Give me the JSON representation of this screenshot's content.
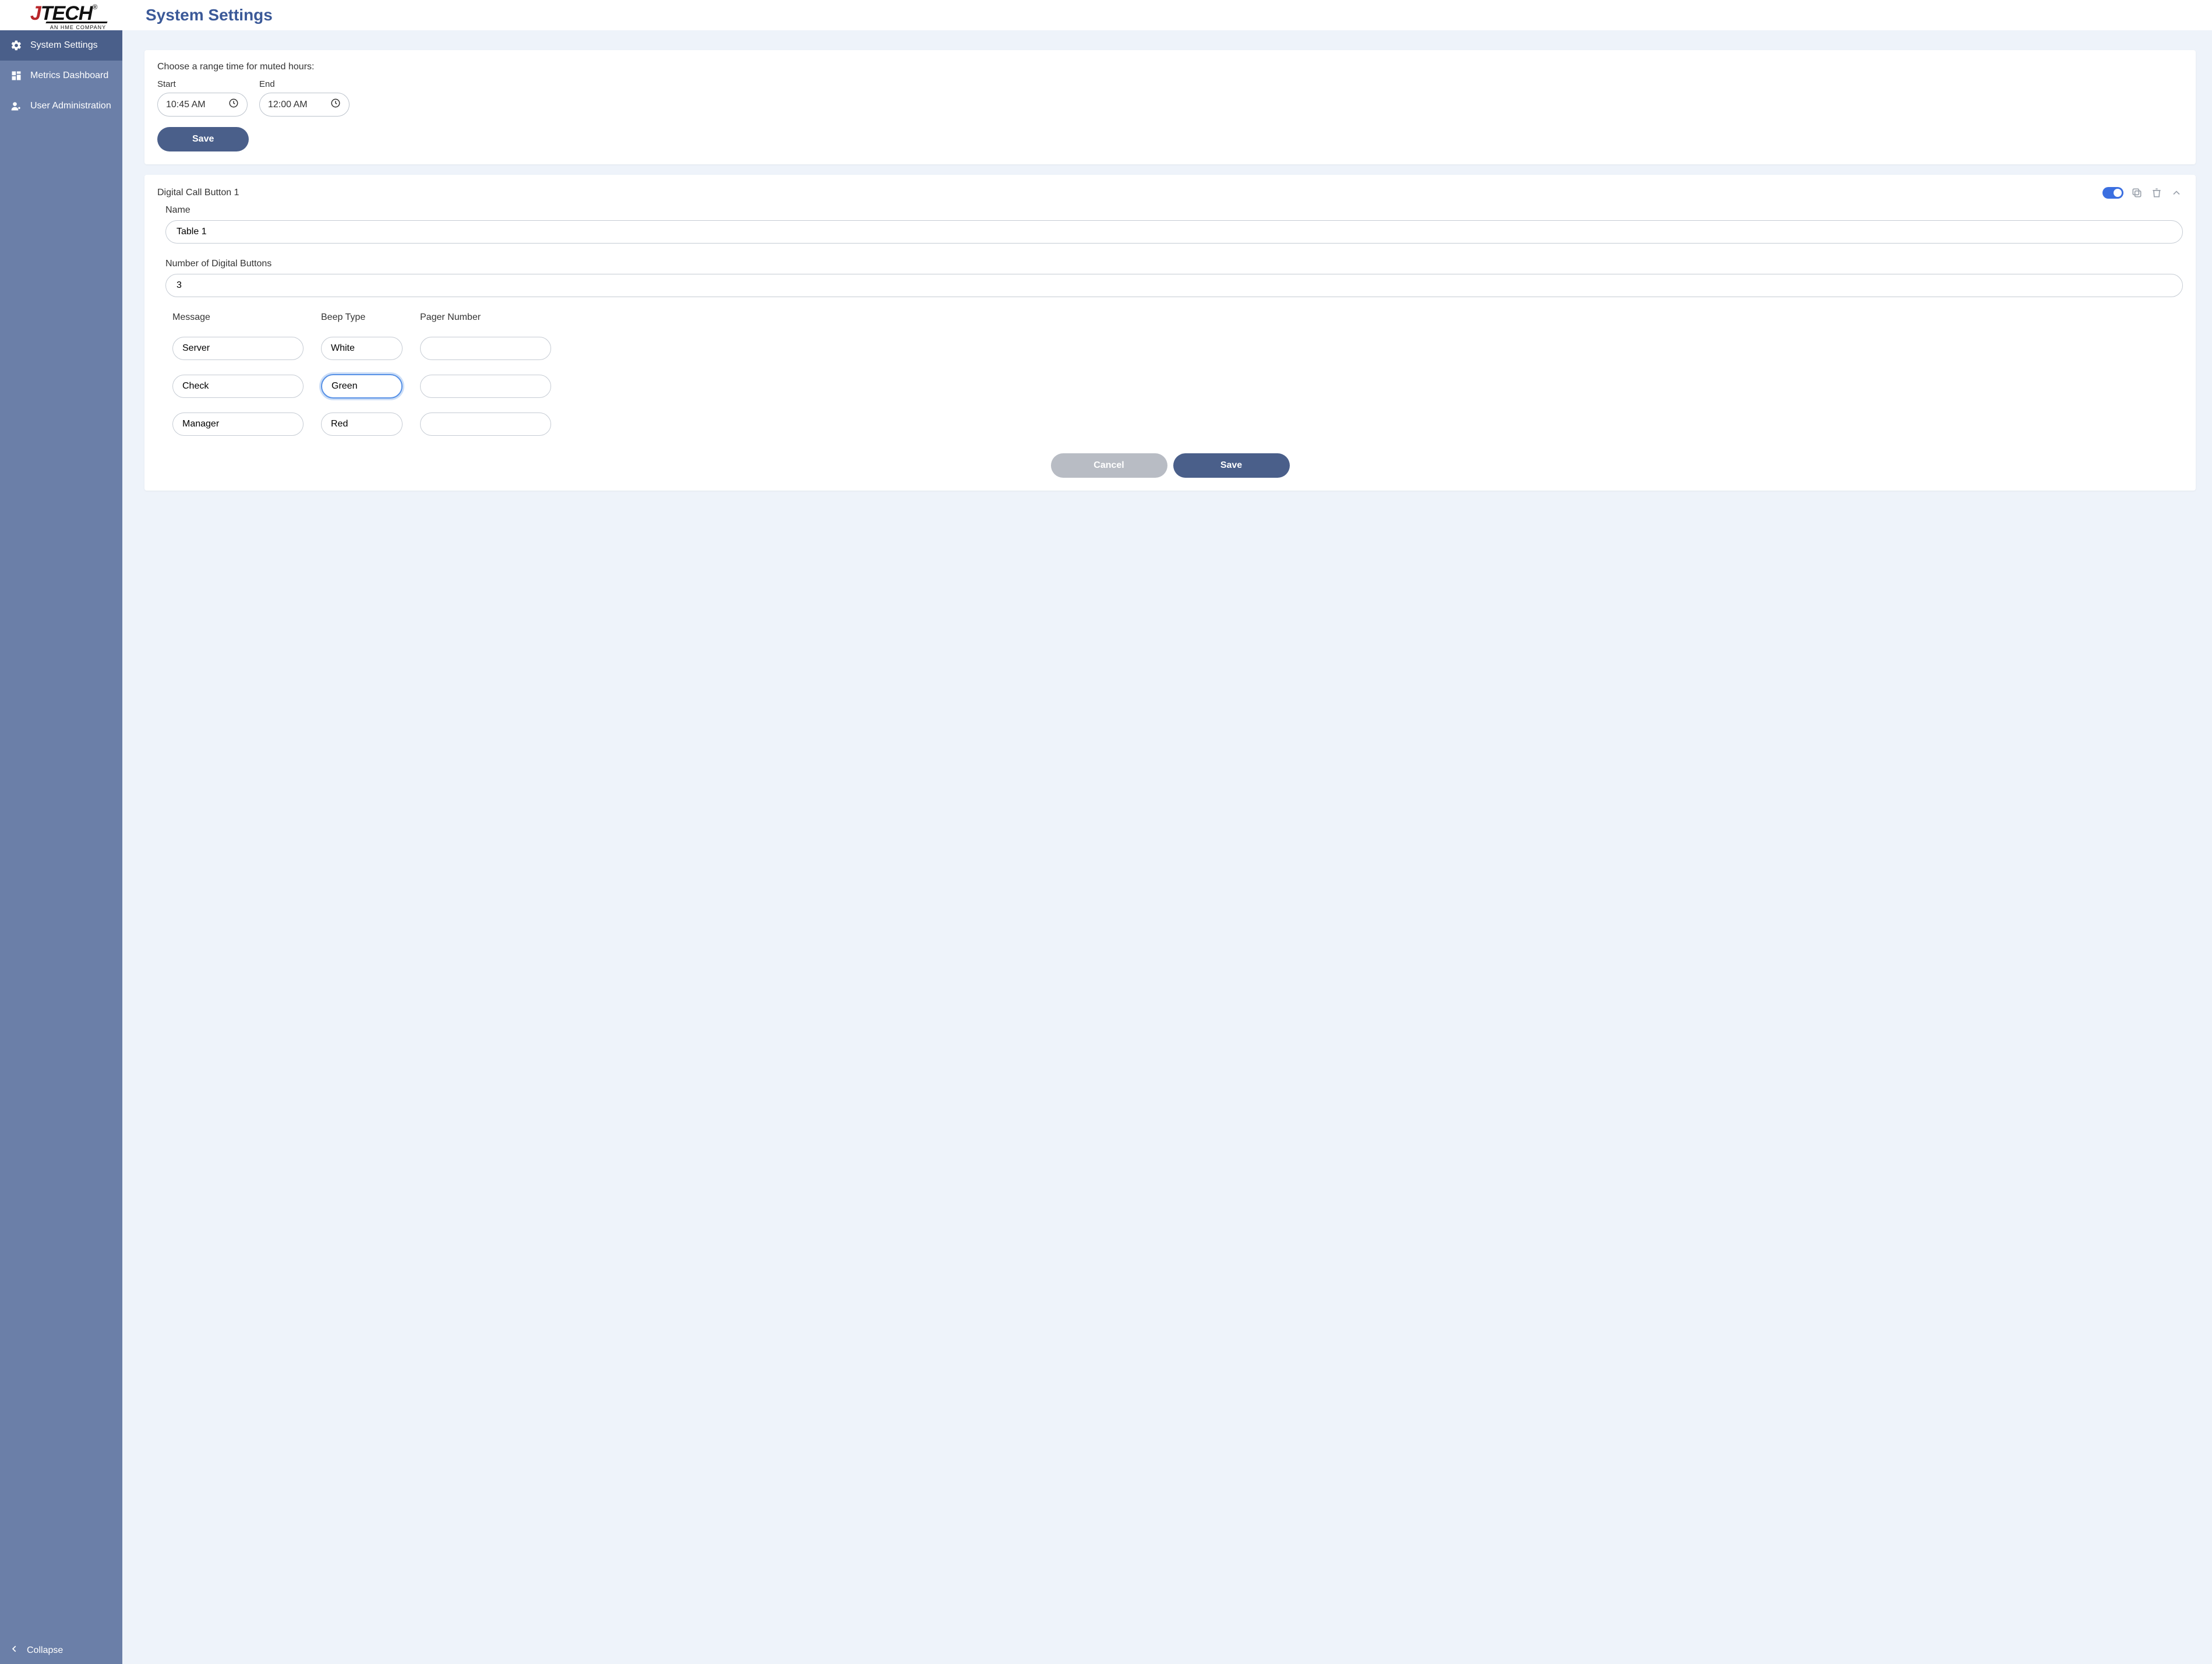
{
  "logo": {
    "j": "J",
    "tech": "TECH",
    "reg": "®",
    "sub": "AN HME COMPANY"
  },
  "page_title": "System Settings",
  "sidebar": {
    "items": [
      {
        "label": "System Settings"
      },
      {
        "label": "Metrics Dashboard"
      },
      {
        "label": "User Administration"
      }
    ],
    "collapse": "Collapse"
  },
  "muted": {
    "prompt": "Choose a range time for muted hours:",
    "start_label": "Start",
    "end_label": "End",
    "start_value": "10:45 AM",
    "end_value": "12:00 AM",
    "save": "Save"
  },
  "dcb": {
    "title": "Digital Call Button 1",
    "name_label": "Name",
    "name_value": "Table 1",
    "count_label": "Number of Digital Buttons",
    "count_value": "3",
    "cols": {
      "message": "Message",
      "beep": "Beep Type",
      "pager": "Pager Number"
    },
    "rows": [
      {
        "message": "Server",
        "beep": "White",
        "pager": ""
      },
      {
        "message": "Check",
        "beep": "Green",
        "pager": ""
      },
      {
        "message": "Manager",
        "beep": "Red",
        "pager": ""
      }
    ],
    "cancel": "Cancel",
    "save": "Save"
  }
}
